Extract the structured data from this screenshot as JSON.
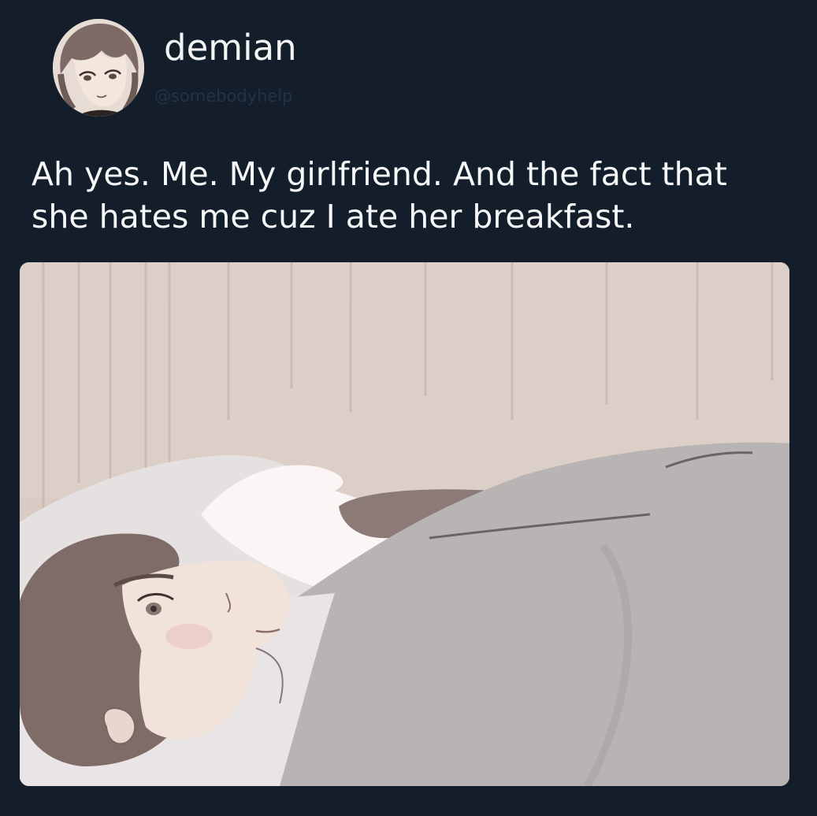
{
  "tweet": {
    "author": {
      "display_name": "demian",
      "handle": "@somebodyhelp"
    },
    "text_lines": [
      "Ah yes. Me. My girlfriend. And the fact that",
      "she hates me cuz I ate her breakfast."
    ]
  },
  "colors": {
    "background": "#141e2b",
    "text": "#f5f7f9",
    "handle": "#233248"
  }
}
